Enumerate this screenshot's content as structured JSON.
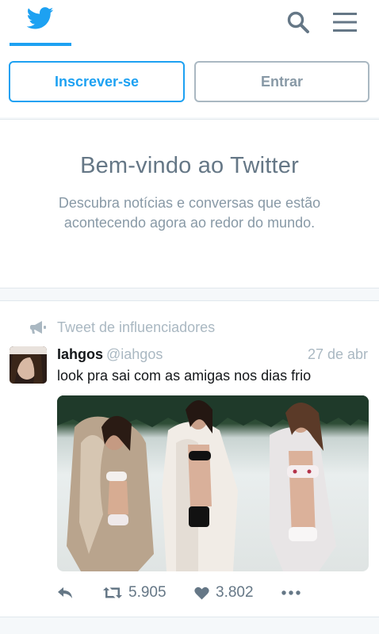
{
  "nav": {
    "logo_icon": "twitter-bird-icon",
    "search_icon": "search-icon",
    "menu_icon": "hamburger-menu-icon",
    "accent": "#1da1f2"
  },
  "auth": {
    "signup_label": "Inscrever-se",
    "login_label": "Entrar"
  },
  "welcome": {
    "title": "Bem-vindo ao Twitter",
    "description": "Descubra notícias e conversas que estão acontecendo agora ao redor do mundo."
  },
  "tweet": {
    "context_icon": "megaphone-icon",
    "context_label": "Tweet de influenciadores",
    "author_name": "Iahgos",
    "author_handle": "@iahgos",
    "time": "27 de abr",
    "text": "look pra sai com as amigas nos dias frio",
    "retweets": "5.905",
    "likes": "3.802",
    "icons": [
      "reply-icon",
      "retweet-icon",
      "heart-icon",
      "more-icon"
    ]
  }
}
